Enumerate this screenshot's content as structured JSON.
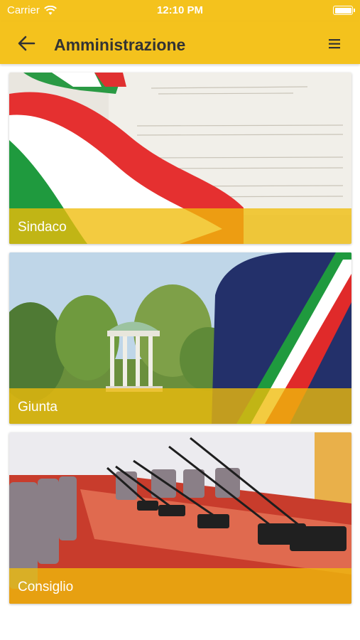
{
  "status_bar": {
    "carrier": "Carrier",
    "time": "12:10 PM",
    "wifi_icon": "wifi-icon",
    "battery_icon": "battery-icon"
  },
  "nav": {
    "title": "Amministrazione",
    "back_icon": "arrow-left-icon",
    "menu_icon": "hamburger-menu-icon"
  },
  "cards": [
    {
      "label": "Sindaco"
    },
    {
      "label": "Giunta"
    },
    {
      "label": "Consiglio"
    }
  ],
  "colors": {
    "accent": "#f4c21d",
    "label_band": "#f0bc0a",
    "title_text": "#333333"
  }
}
